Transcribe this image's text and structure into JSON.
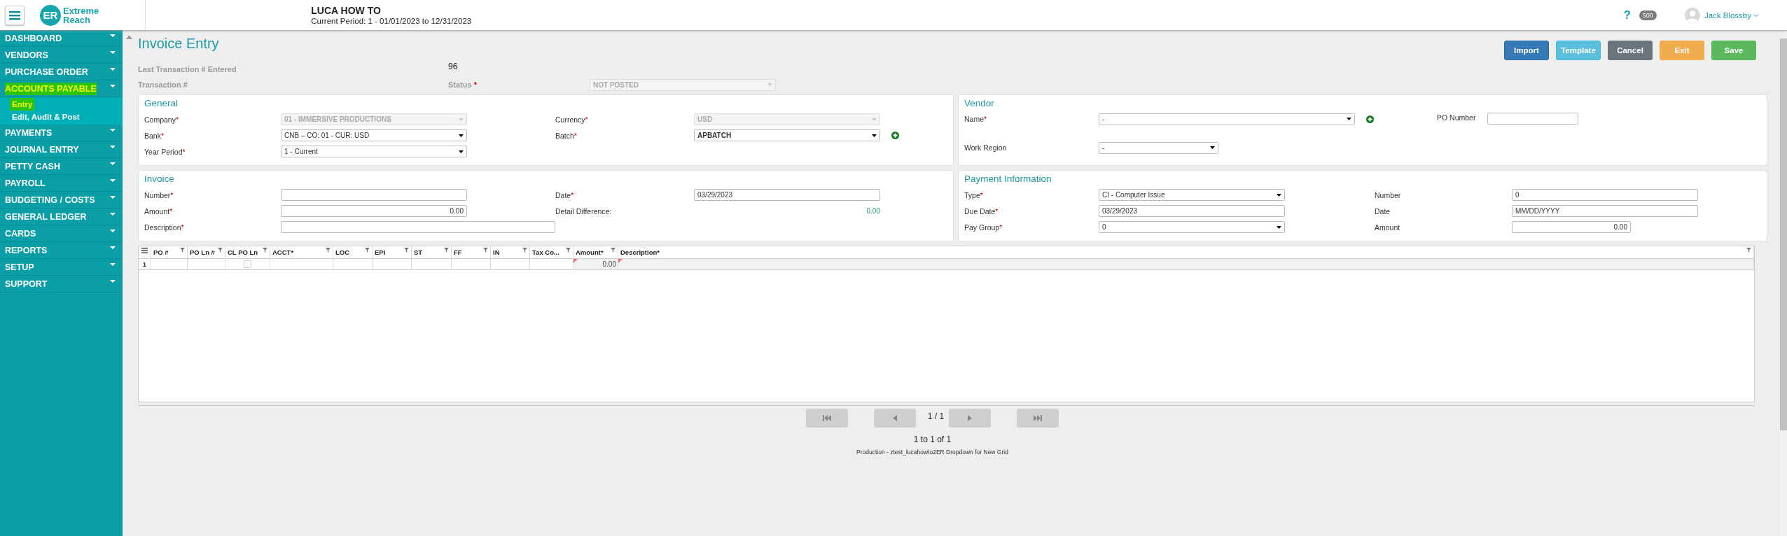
{
  "header": {
    "logo": {
      "initials": "ER",
      "line1": "Extreme",
      "line2": "Reach"
    },
    "project": "LUCA HOW TO",
    "period": "Current Period: 1 - 01/01/2023 to 12/31/2023",
    "help": "?",
    "badge": "500",
    "user": "Jack Blossby"
  },
  "sidebar": {
    "items": [
      {
        "label": "DASHBOARD",
        "selected": false
      },
      {
        "label": "VENDORS",
        "selected": false
      },
      {
        "label": "PURCHASE ORDER",
        "selected": false
      },
      {
        "label": "ACCOUNTS PAYABLE",
        "selected": true,
        "children": [
          {
            "label": "Entry",
            "selected": true
          },
          {
            "label": "Edit, Audit & Post",
            "selected": false
          }
        ]
      },
      {
        "label": "PAYMENTS",
        "selected": false
      },
      {
        "label": "JOURNAL ENTRY",
        "selected": false
      },
      {
        "label": "PETTY CASH",
        "selected": false
      },
      {
        "label": "PAYROLL",
        "selected": false
      },
      {
        "label": "BUDGETING / COSTS",
        "selected": false
      },
      {
        "label": "GENERAL LEDGER",
        "selected": false
      },
      {
        "label": "CARDS",
        "selected": false
      },
      {
        "label": "REPORTS",
        "selected": false
      },
      {
        "label": "SETUP",
        "selected": false
      },
      {
        "label": "SUPPORT",
        "selected": false
      }
    ]
  },
  "page": {
    "title": "Invoice Entry",
    "buttons": [
      {
        "label": "Import",
        "kind": "primary"
      },
      {
        "label": "Template",
        "kind": "info"
      },
      {
        "label": "Cancel",
        "kind": "secondary"
      },
      {
        "label": "Exit",
        "kind": "warning"
      },
      {
        "label": "Save",
        "kind": "success"
      }
    ],
    "last_transaction": {
      "label": "Last Transaction # Entered",
      "value": "96"
    },
    "transaction": {
      "label": "Transaction #"
    },
    "status": {
      "label": "Status",
      "required_mark": "*",
      "value": "NOT POSTED"
    }
  },
  "panels": [
    {
      "title": "General",
      "rows": [
        [
          {
            "label": "Company",
            "required_mark": "*",
            "kind": "disabled-select",
            "value": "01 - IMMERSIVE PRODUCTIONS"
          },
          {
            "label": "Currency",
            "required_mark": "*",
            "kind": "disabled-select",
            "value": "USD"
          }
        ],
        [
          {
            "label": "Bank",
            "required_mark": "*",
            "kind": "select",
            "value": "CNB – CO: 01 - CUR: USD"
          },
          {
            "label": "Batch",
            "required_mark": "*",
            "kind": "select-add",
            "value": "APBATCH"
          }
        ],
        [
          {
            "label": "Year Period",
            "required_mark": "*",
            "kind": "select",
            "value": "1 - Current"
          }
        ]
      ]
    },
    {
      "title": "Vendor",
      "rows": [
        [
          {
            "label": "Name",
            "required_mark": "*",
            "kind": "select-wide-add",
            "value": "-"
          },
          {
            "label": "PO Number",
            "kind": "input-short"
          }
        ],
        [
          {
            "label": "Work Region",
            "kind": "select-short",
            "value": "-"
          }
        ]
      ]
    },
    {
      "title": "Invoice",
      "rows": [
        [
          {
            "label": "Number",
            "required_mark": "*",
            "kind": "input"
          },
          {
            "label": "Date",
            "required_mark": "*",
            "kind": "input",
            "value": "03/29/2023"
          }
        ],
        [
          {
            "label": "Amount",
            "required_mark": "*",
            "kind": "input-number",
            "value": "0.00"
          },
          {
            "label": "Detail Difference:",
            "kind": "reading",
            "value": "0.00"
          }
        ],
        [
          {
            "label": "Description",
            "required_mark": "*",
            "kind": "input-wide"
          }
        ]
      ]
    },
    {
      "title": "Payment Information",
      "rows": [
        [
          {
            "label": "Type",
            "required_mark": "*",
            "kind": "select",
            "value": "CI - Computer Issue"
          },
          {
            "label": "Number",
            "kind": "input",
            "value": "0"
          }
        ],
        [
          {
            "label": "Due Date",
            "required_mark": "*",
            "kind": "input",
            "value": "03/29/2023"
          },
          {
            "label": "Date",
            "kind": "input",
            "placeholder": "MM/DD/YYYY"
          }
        ],
        [
          {
            "label": "Pay Group",
            "required_mark": "*",
            "kind": "select",
            "value": "0"
          },
          {
            "label": "Amount",
            "kind": "input-number-short",
            "value": "0.00"
          }
        ]
      ]
    }
  ],
  "grid": {
    "columns": [
      "PO #",
      "PO Ln #",
      "CL PO Ln",
      "ACCT*",
      "LOC",
      "EPI",
      "ST",
      "FF",
      "IN",
      "Tax Co...",
      "Amount*",
      "Description*"
    ],
    "rows": [
      {
        "number": "1",
        "cells": [
          {
            "kind": "blank"
          },
          {
            "kind": "blank"
          },
          {
            "kind": "checkbox",
            "checked": false
          },
          {
            "kind": "blank"
          },
          {
            "kind": "blank"
          },
          {
            "kind": "blank"
          },
          {
            "kind": "blank"
          },
          {
            "kind": "blank"
          },
          {
            "kind": "blank"
          },
          {
            "kind": "blank"
          },
          {
            "kind": "amount",
            "value": "0.00",
            "flagged": true
          },
          {
            "kind": "blank",
            "flagged": true
          }
        ]
      }
    ]
  },
  "pager": {
    "first_disabled": true,
    "prev_disabled": true,
    "page": "1 / 1",
    "next_disabled": true,
    "last_disabled": true,
    "summary": "1 to 1 of 1"
  },
  "footer": "Production - ztest_lucahowto2ER Dropdown for New Grid"
}
